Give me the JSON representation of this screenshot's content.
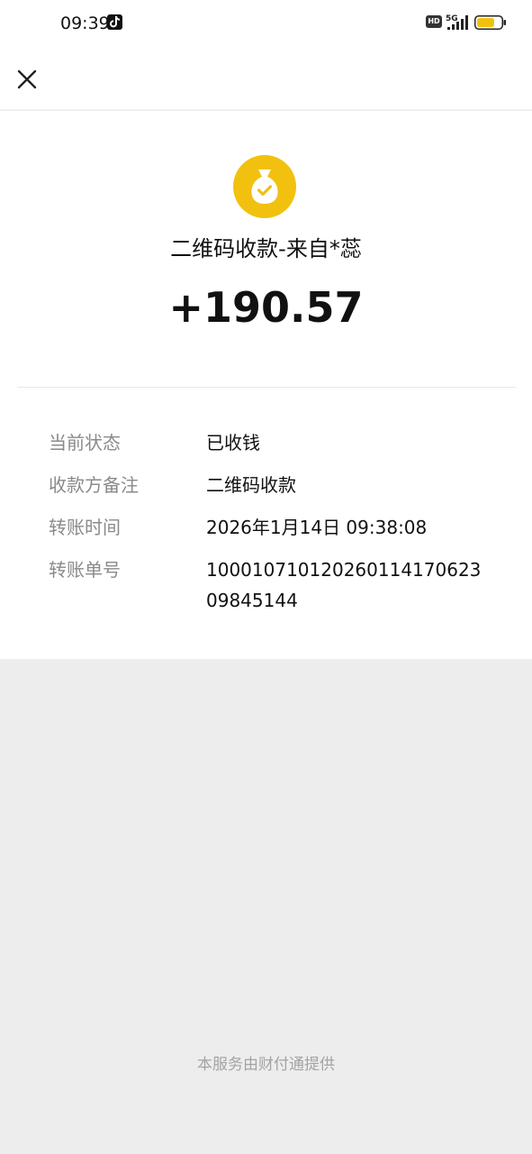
{
  "status_bar": {
    "time": "09:39",
    "hd_label": "HD",
    "network": "5G",
    "battery_color": "#f2c10f"
  },
  "header": {
    "close_icon": "close-icon"
  },
  "receipt": {
    "icon": "money-bag-check-icon",
    "icon_color": "#f2c10f",
    "title": "二维码收款-来自*蕊",
    "amount": "+190.57"
  },
  "details": [
    {
      "label": "当前状态",
      "value": "已收钱"
    },
    {
      "label": "收款方备注",
      "value": "二维码收款"
    },
    {
      "label": "转账时间",
      "value": "2026年1月14日 09:38:08"
    },
    {
      "label": "转账单号",
      "value": "100010710120260114170623 09845144"
    }
  ],
  "footer": {
    "text": "本服务由财付通提供"
  }
}
